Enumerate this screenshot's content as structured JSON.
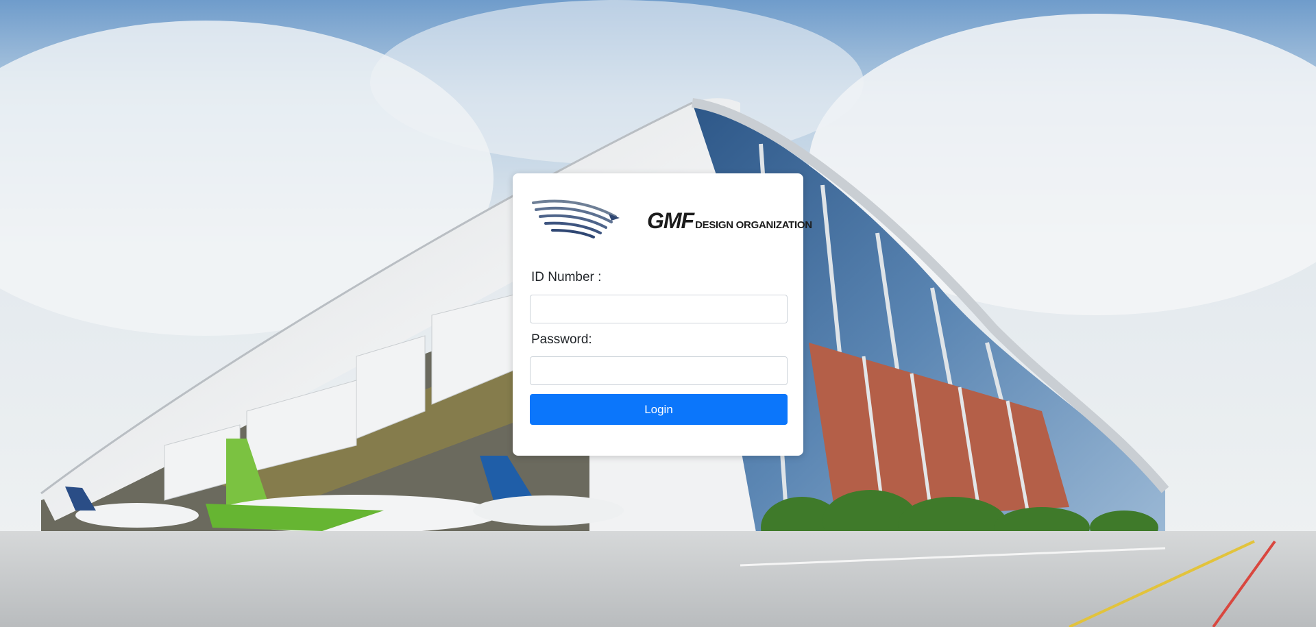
{
  "background": {
    "description_icon": "hangar-photo",
    "colors": {
      "sky_top": "#8fb4d8",
      "hangar_roof": "#e6e8ea",
      "brick": "#b55f4a",
      "glass": "#3f6e9e",
      "grass": "#4f8a2b"
    }
  },
  "login": {
    "logo": {
      "brand": "GMF",
      "subtitle": "DESIGN ORGANIZATION"
    },
    "id_label": "ID Number :",
    "id_value": "",
    "password_label": "Password:",
    "password_value": "",
    "button_label": "Login",
    "accent_color": "#0b76fb"
  }
}
